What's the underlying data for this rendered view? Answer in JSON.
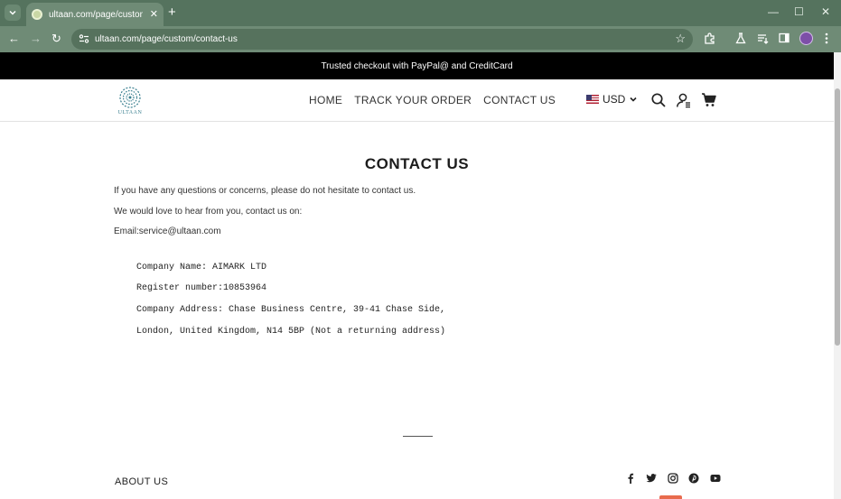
{
  "browser": {
    "tab_title": "ultaan.com/page/custom/contact-us",
    "url": "ultaan.com/page/custom/contact-us",
    "controls": {
      "tab_close": "✕",
      "new_tab": "+",
      "minimize": "—",
      "maximize": "☐",
      "close": "✕",
      "back": "←",
      "forward": "→",
      "reload": "↻",
      "bookmark": "☆"
    },
    "toolbar_icons": [
      "extensions-icon",
      "labs-icon",
      "reading-list-icon",
      "side-panel-icon",
      "profile-avatar",
      "menu-icon"
    ],
    "theme_color": "#55735e"
  },
  "page": {
    "announcement": "Trusted checkout with PayPal@ and CreditCard",
    "logo_text": "ULTAAN",
    "nav": [
      "HOME",
      "TRACK YOUR ORDER",
      "CONTACT US"
    ],
    "currency": "USD",
    "header_icons": [
      "search-icon",
      "account-icon",
      "cart-icon"
    ],
    "title": "CONTACT US",
    "paragraphs": [
      "If you have any questions or concerns, please do not hesitate to contact us.",
      "We would love to hear from you, contact us on:",
      "Email:service@ultaan.com"
    ],
    "company": [
      "Company Name: AIMARK LTD",
      "Register number:10853964",
      "Company Address: Chase Business Centre, 39-41 Chase Side,",
      "London, United Kingdom, N14 5BP (Not a returning address)"
    ],
    "footer": {
      "about": "ABOUT US",
      "social": [
        "facebook-icon",
        "twitter-icon",
        "instagram-icon",
        "pinterest-icon",
        "youtube-icon"
      ]
    },
    "accent": "#3a7f8f"
  }
}
